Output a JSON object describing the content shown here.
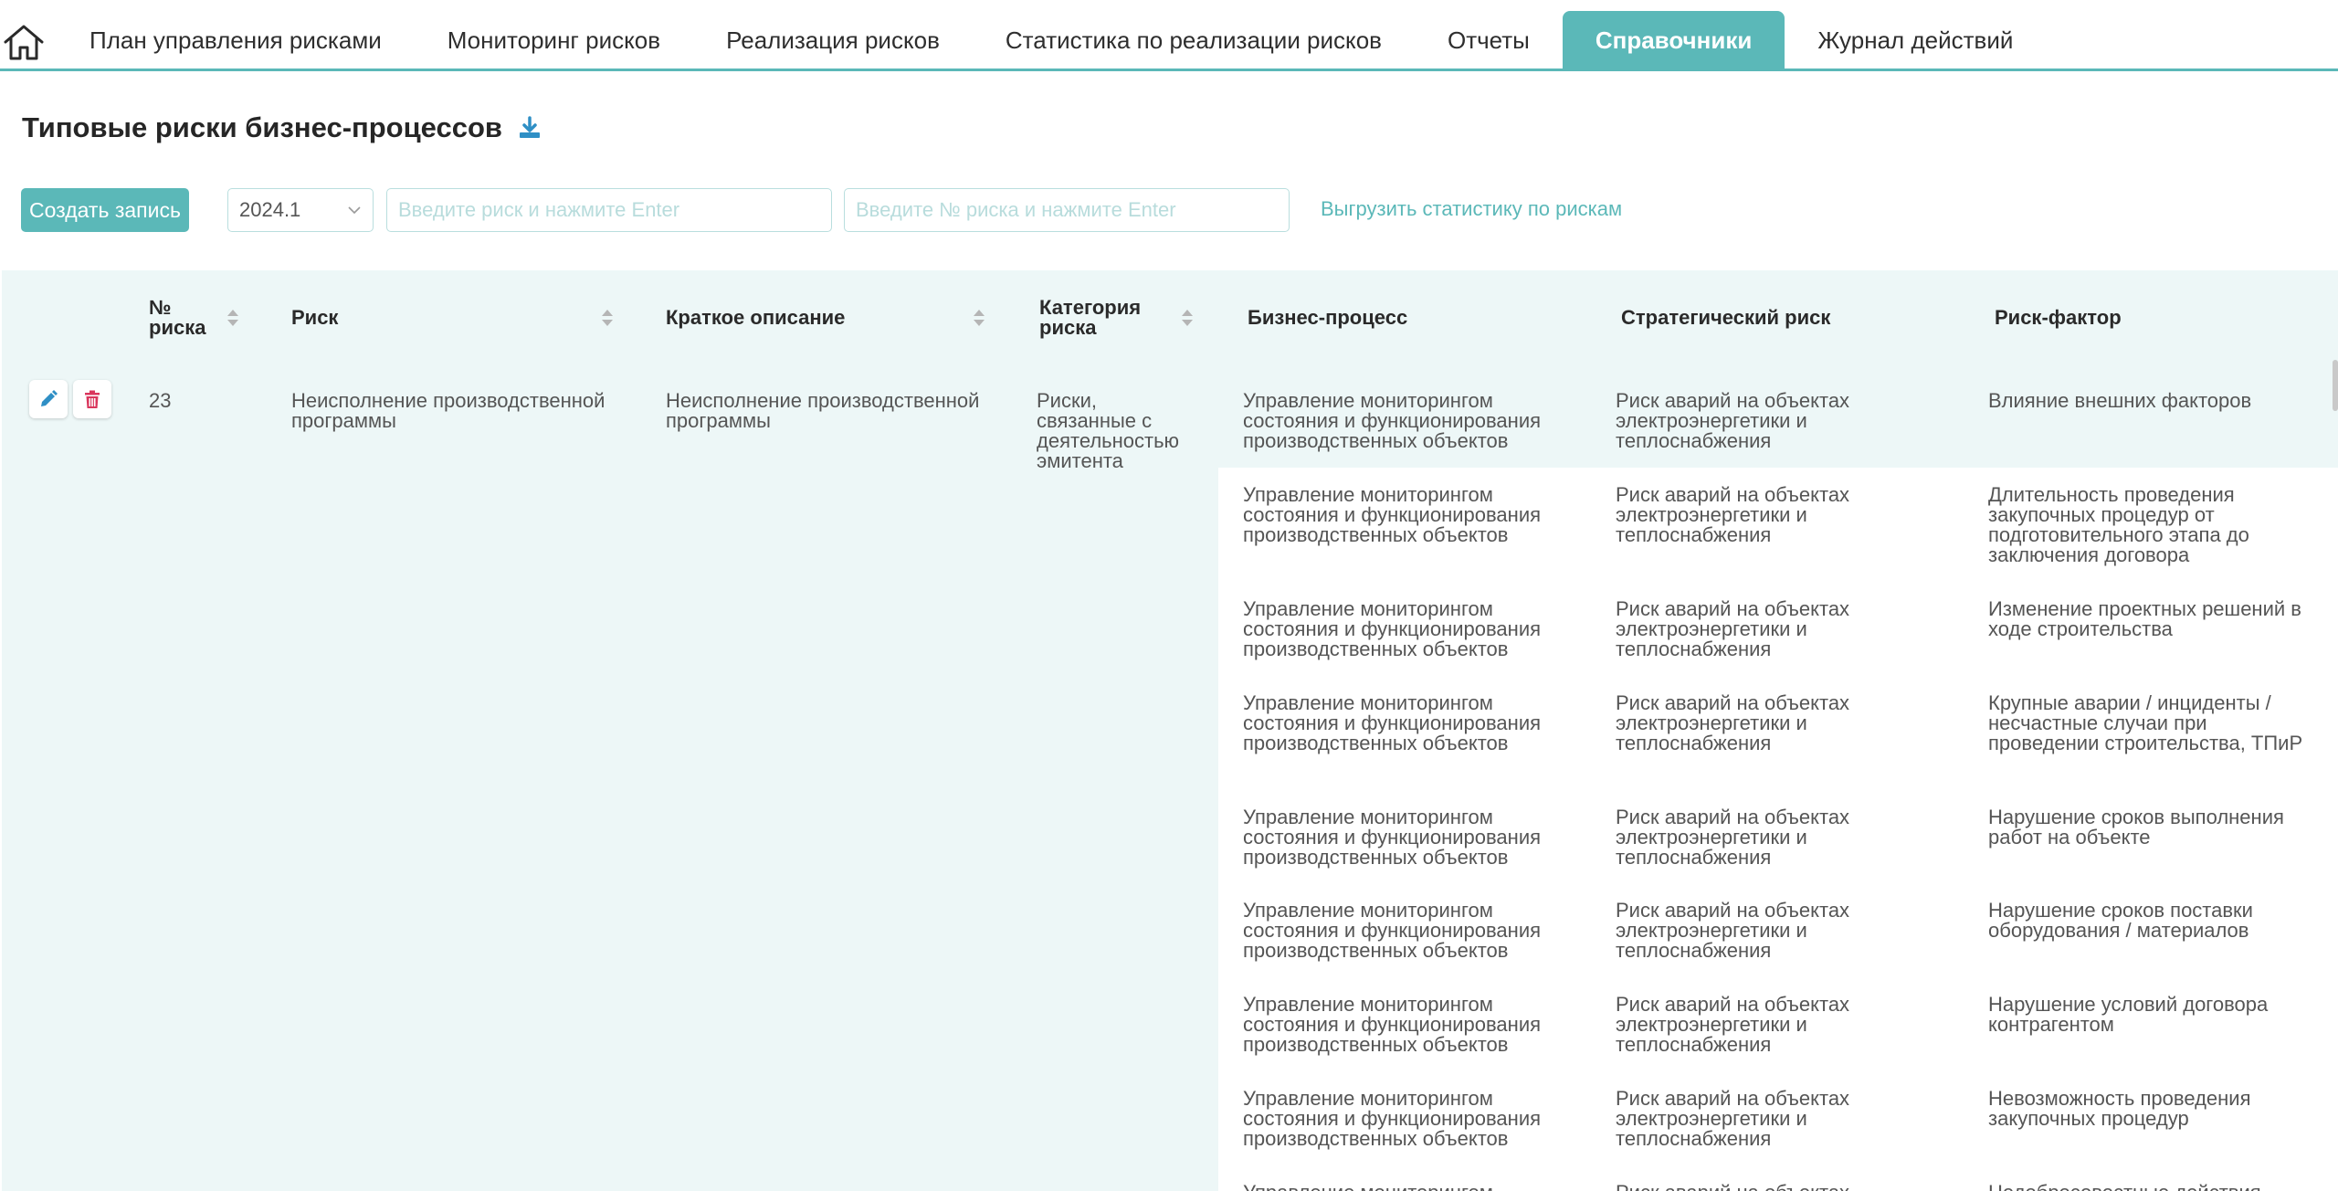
{
  "nav": {
    "tabs": [
      {
        "label": "План управления рисками",
        "active": false
      },
      {
        "label": "Мониторинг рисков",
        "active": false
      },
      {
        "label": "Реализация рисков",
        "active": false
      },
      {
        "label": "Статистика по реализации рисков",
        "active": false
      },
      {
        "label": "Отчеты",
        "active": false
      },
      {
        "label": "Справочники",
        "active": true
      },
      {
        "label": "Журнал действий",
        "active": false
      }
    ]
  },
  "page": {
    "title": "Типовые риски бизнес-процессов"
  },
  "toolbar": {
    "create_label": "Создать запись",
    "version_value": "2024.1",
    "risk_search_placeholder": "Введите риск и нажмите Enter",
    "risk_number_placeholder": "Введите № риска и нажмите Enter",
    "export_label": "Выгрузить статистику по рискам"
  },
  "table": {
    "columns": {
      "number": "№ риска",
      "risk": "Риск",
      "description": "Краткое описание",
      "category": "Категория риска",
      "process": "Бизнес-процесс",
      "strategic": "Стратегический риск",
      "factor": "Риск-фактор"
    },
    "row": {
      "number": "23",
      "risk": "Неисполнение производственной программы",
      "description": "Неисполнение производственной программы",
      "category": "Риски, связанные с деятельностью эмитента",
      "subrows": [
        {
          "process": "Управление мониторингом состояния и функционирования производственных объектов",
          "strategic": "Риск аварий на объектах электроэнергетики и теплоснабжения",
          "factor": "Влияние внешних факторов"
        },
        {
          "process": "Управление мониторингом состояния и функционирования производственных объектов",
          "strategic": "Риск аварий на объектах электроэнергетики и теплоснабжения",
          "factor": "Длительность проведения закупочных процедур от подготовительного этапа до заключения договора"
        },
        {
          "process": "Управление мониторингом состояния и функционирования производственных объектов",
          "strategic": "Риск аварий на объектах электроэнергетики и теплоснабжения",
          "factor": "Изменение проектных решений в ходе строительства"
        },
        {
          "process": "Управление мониторингом состояния и функционирования производственных объектов",
          "strategic": "Риск аварий на объектах электроэнергетики и теплоснабжения",
          "factor": "Крупные аварии / инциденты / несчастные случаи при проведении строительства, ТПиР"
        },
        {
          "process": "Управление мониторингом состояния и функционирования производственных объектов",
          "strategic": "Риск аварий на объектах электроэнергетики и теплоснабжения",
          "factor": "Нарушение сроков выполнения работ на объекте"
        },
        {
          "process": "Управление мониторингом состояния и функционирования производственных объектов",
          "strategic": "Риск аварий на объектах электроэнергетики и теплоснабжения",
          "factor": "Нарушение сроков поставки оборудования / материалов"
        },
        {
          "process": "Управление мониторингом состояния и функционирования производственных объектов",
          "strategic": "Риск аварий на объектах электроэнергетики и теплоснабжения",
          "factor": "Нарушение условий договора контрагентом"
        },
        {
          "process": "Управление мониторингом состояния и функционирования производственных объектов",
          "strategic": "Риск аварий на объектах электроэнергетики и теплоснабжения",
          "factor": "Невозможность проведения закупочных процедур"
        },
        {
          "process": "Управление мониторингом состояния и функционирования производственных объектов",
          "strategic": "Риск аварий на объектах электроэнергетики и теплоснабжения",
          "factor": "Недобросовестные действия"
        }
      ]
    }
  },
  "colors": {
    "accent": "#5bb8b8",
    "table_bg": "#edf7f7",
    "delete": "#d9365c",
    "edit": "#2f8fc5"
  }
}
